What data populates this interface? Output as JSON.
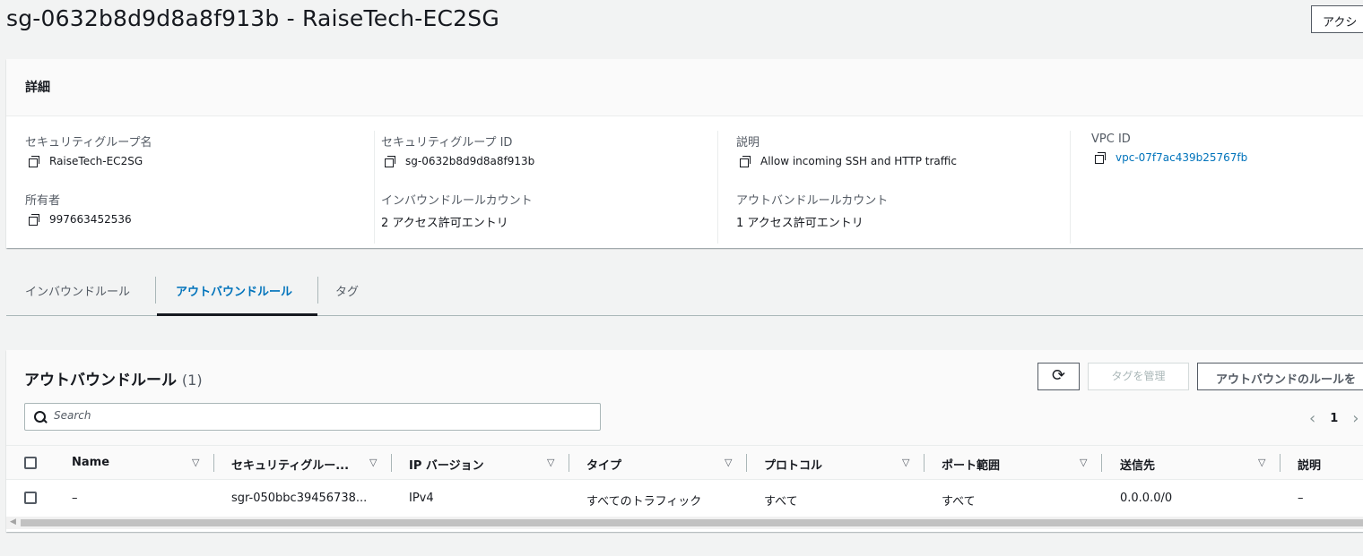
{
  "header": {
    "title": "sg-0632b8d9d8a8f913b - RaiseTech-EC2SG",
    "actions_label": "アクシ"
  },
  "details": {
    "heading": "詳細",
    "fields": {
      "sg_name": {
        "label": "セキュリティグループ名",
        "value": "RaiseTech-EC2SG"
      },
      "sg_id": {
        "label": "セキュリティグループ ID",
        "value": "sg-0632b8d9d8a8f913b"
      },
      "description": {
        "label": "説明",
        "value": "Allow incoming SSH and HTTP traffic"
      },
      "vpc_id": {
        "label": "VPC ID",
        "value": "vpc-07f7ac439b25767fb"
      },
      "owner": {
        "label": "所有者",
        "value": "997663452536"
      },
      "inbound_count": {
        "label": "インバウンドルールカウント",
        "value": "2 アクセス許可エントリ"
      },
      "outbound_count": {
        "label": "アウトバンドルールカウント",
        "value": "1 アクセス許可エントリ"
      }
    }
  },
  "tabs": [
    {
      "label": "インバウンドルール",
      "active": false
    },
    {
      "label": "アウトバウンドルール",
      "active": true
    },
    {
      "label": "タグ",
      "active": false
    }
  ],
  "rules_table": {
    "title": "アウトバウンドルール",
    "count": "(1)",
    "refresh_icon": "refresh-icon",
    "manage_tags_label": "タグを管理",
    "edit_outbound_label": "アウトバウンドのルールを",
    "search_placeholder": "Search",
    "pager": {
      "prev": "‹",
      "page": "1",
      "next": "›"
    },
    "columns": [
      "Name",
      "セキュリティグルー...",
      "IP バージョン",
      "タイプ",
      "プロトコル",
      "ポート範囲",
      "送信先",
      "説明"
    ],
    "rows": [
      [
        "–",
        "sgr-050bbc39456738...",
        "IPv4",
        "すべてのトラフィック",
        "すべて",
        "すべて",
        "0.0.0.0/0",
        "–"
      ]
    ]
  }
}
